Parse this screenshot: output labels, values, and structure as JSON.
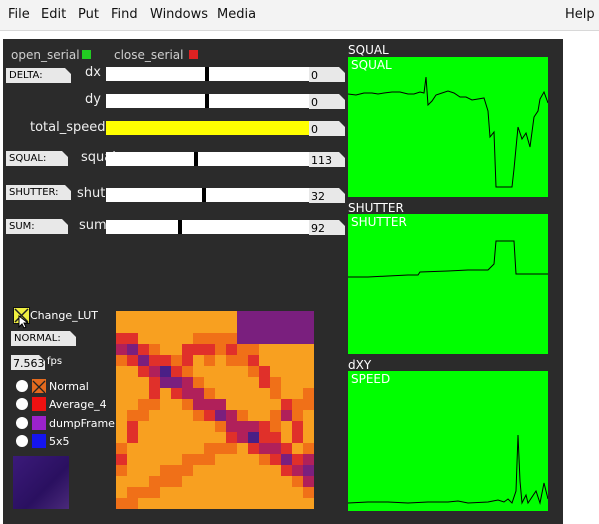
{
  "menu": {
    "file": "File",
    "edit": "Edit",
    "put": "Put",
    "find": "Find",
    "windows": "Windows",
    "media": "Media",
    "help": "Help"
  },
  "serial": {
    "open": "open_serial",
    "close": "close_serial",
    "open_color": "#22cc22",
    "close_color": "#dd2222"
  },
  "rows": {
    "delta_flag": "DELTA:",
    "dx_label": "dx",
    "dx_value": "0",
    "dy_label": "dy",
    "dy_value": "0",
    "total_speed_label": "total_speed",
    "total_speed_value": "0",
    "squal_flag": "SQUAL:",
    "squal_label": "squal",
    "squal_value": "113",
    "shutter_flag": "SHUTTER:",
    "shutter_label": "shut",
    "shutter_value": "32",
    "sum_flag": "SUM:",
    "sum_label": "sum",
    "sum_value": "92"
  },
  "controls": {
    "change_lut": "Change_LUT",
    "normal_flag": "NORMAL:",
    "fps_value": "7.563",
    "fps_unit": "fps",
    "options": [
      "Normal",
      "Average_4",
      "dumpFrame",
      "5x5"
    ],
    "option_colors": [
      "#e36a1e",
      "#ee1111",
      "#9b22cc",
      "#1515ee"
    ]
  },
  "graphs": {
    "squal_title": "SQUAL",
    "squal_inner": "SQUAL",
    "shutter_title": "SHUTTER",
    "shutter_inner": "SHUTTER",
    "dxy_title": "dXY",
    "dxy_inner": "SPEED",
    "bg_color": "#00ff00"
  }
}
